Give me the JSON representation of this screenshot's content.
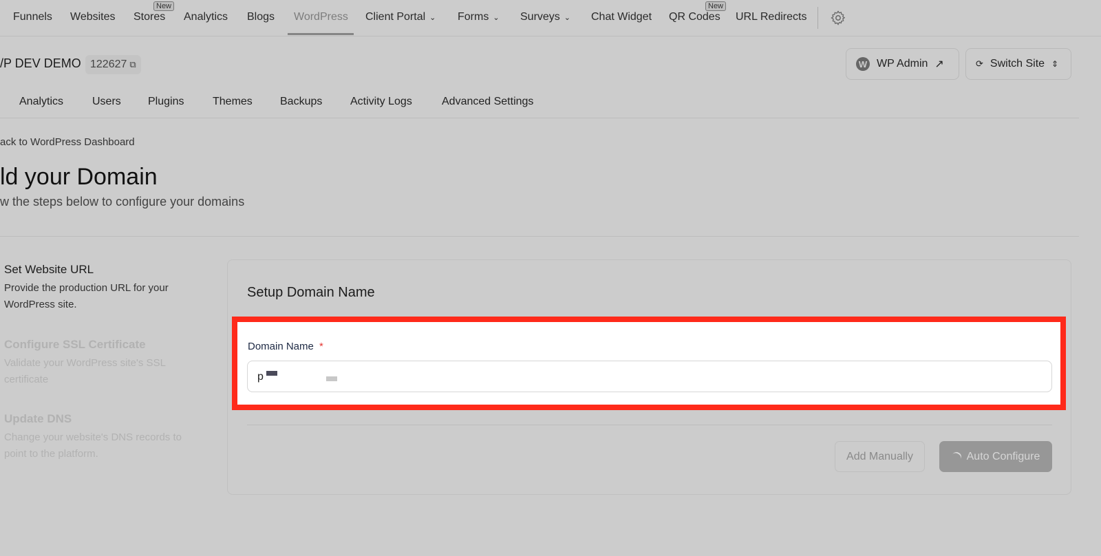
{
  "topnav": {
    "items": [
      {
        "label": "Funnels"
      },
      {
        "label": "Websites"
      },
      {
        "label": "Stores",
        "badge": "New"
      },
      {
        "label": "Analytics"
      },
      {
        "label": "Blogs"
      },
      {
        "label": "WordPress",
        "active": true
      },
      {
        "label": "Client Portal",
        "dropdown": true
      },
      {
        "label": "Forms",
        "dropdown": true
      },
      {
        "label": "Surveys",
        "dropdown": true
      },
      {
        "label": "Chat Widget"
      },
      {
        "label": "QR Codes",
        "badge": "New"
      },
      {
        "label": "URL Redirects"
      }
    ],
    "settings_icon": "gear-icon"
  },
  "site": {
    "name": "/P DEV DEMO",
    "id": "122627",
    "wp_admin_label": "WP Admin",
    "switch_site_label": "Switch Site"
  },
  "subtabs": [
    "Analytics",
    "Users",
    "Plugins",
    "Themes",
    "Backups",
    "Activity Logs",
    "Advanced Settings"
  ],
  "back_link": "ack to WordPress Dashboard",
  "page": {
    "title": "ld your Domain",
    "subtitle": "w the steps below to configure your domains"
  },
  "steps": [
    {
      "title": "Set Website URL",
      "desc": "Provide the production URL for your WordPress site.",
      "active": true
    },
    {
      "title": "Configure SSL Certificate",
      "desc": "Validate your WordPress site's SSL certificate",
      "active": false
    },
    {
      "title": "Update DNS",
      "desc": "Change your website's DNS records to point to the platform.",
      "active": false
    }
  ],
  "card": {
    "title": "Setup Domain Name",
    "field_label": "Domain Name",
    "required_mark": "*",
    "field_value": "p",
    "add_manually": "Add Manually",
    "auto_configure": "Auto Configure"
  },
  "colors": {
    "highlight": "#ff2a1a",
    "overlay": "#cccccc",
    "required": "#e53935"
  }
}
